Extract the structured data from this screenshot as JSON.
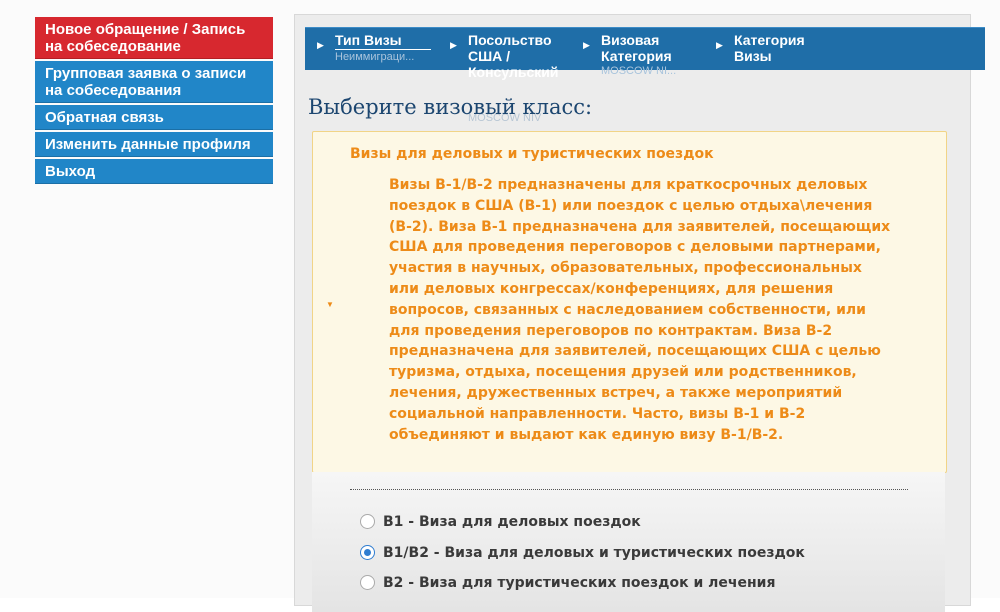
{
  "sidebar": {
    "items": [
      {
        "label": "Новое обращение / Запись на собеседование",
        "active": true
      },
      {
        "label": "Групповая заявка о записи на собеседования",
        "active": false
      },
      {
        "label": "Обратная связь",
        "active": false
      },
      {
        "label": "Изменить данные профиля",
        "active": false
      },
      {
        "label": "Выход",
        "active": false
      }
    ]
  },
  "steps": [
    {
      "label": "Тип Визы",
      "value": "Неиммиграци..."
    },
    {
      "label": "Посольство США / Консульский",
      "value": "MOSCOW NIV"
    },
    {
      "label": "Визовая Категория",
      "value": "MOSCOW NI..."
    },
    {
      "label": "Категория Визы",
      "value": ""
    }
  ],
  "main": {
    "heading": "Выберите визовый класс:",
    "info_title": "Визы для деловых и туристических поездок",
    "info_text": "Визы B-1/B-2 предназначены для краткосрочных деловых\nпоездок в США (B-1) или поездок с  целью отдыха\\лечения\n(B-2). Виза B-1 предназначена для заявителей,  посещающих\nСША для проведения переговоров с деловыми партнерами,\nучастия в научных, образовательных, профессиональных\nили деловых конгрессах/конференциях, для решения\n вопросов,  связанных с наследованием собственности,  или\nдля проведения переговоров по контрактам. Виза B-2\nпредназначена для заявителей, посещающих США с целью\nтуризма, отдыха, посещения друзей или родственников,\nлечения, дружественных встреч, а также мероприятий\nсоциальной направленности. Часто, визы B-1 и B-2\nобъединяют и выдают как единую  визу  B-1/B-2.",
    "options": [
      {
        "label": "B1 - Виза для деловых поездок",
        "selected": false
      },
      {
        "label": "B1/B2 - Виза для деловых и туристических поездок",
        "selected": true
      },
      {
        "label": "B2 - Виза для туристических поездок и лечения",
        "selected": false
      }
    ]
  },
  "colors": {
    "sidebar_active": "#d7282f",
    "sidebar_item": "#2186c8",
    "steps_bar": "#1f6ea8",
    "info_text": "#ed8b18",
    "heading": "#1c4670"
  }
}
